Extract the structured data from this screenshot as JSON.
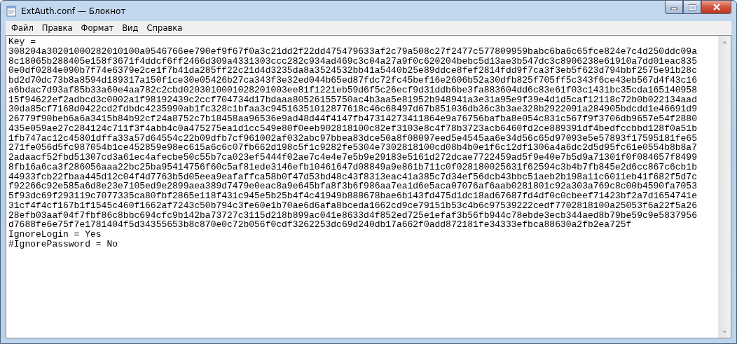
{
  "window": {
    "title": "ExtAuth.conf — Блокнот"
  },
  "menu": [
    "Файл",
    "Правка",
    "Формат",
    "Вид",
    "Справка"
  ],
  "lines": [
    "Key =",
    "308204a30201000282010100a0546766ee790ef9f67f0a3c21dd2f22dd475479633af2c79a508c27f2477c577809959babc6ba6c65fce824e7c4d250ddc09a",
    "8c18065b288405e158f3671f4ddcf6ff2466d309a4331303ccc282c934ad469c3c04a27a9f0c620204bebc5d13ae3b547dc3c8906238e61910a7dd01eac835",
    "0e0df0284e090b7f74e6379e2ce1f7b41da285ff22c21d4d3235da8a3524532bb41a5440b25e89ddce8fef2814fdd9f7ca3f3eb5f623d794bbf2575e91b28c",
    "bd2d70dc73b8a8594d189317a150f1ce30e05426b27ca343f3e32ed044b65ed87fdc72fc45bef16e2606b52a30dfb825f705ff5c343f6ce43eb567d4f43c16",
    "a6bdac7d93af85b33a60e4aa782c2cbd0203010001028201003ee81f1221eb59d6f5c26ecf9d31ddb6be3fa883604dd6c83e61f03c1431bc35cda165140958",
    "15f94622ef2adbcd3c0002a1f98192439c2ccf704734d17bdaaa80526155750ac4b3aa5e81952b948941a3e31a95e9f39e4d1d5caf12118c72b0b022134aad",
    "30da85cf7168d0422cd2fdbdc4235990ab1fc328c1bfaa3c94516351012877618c46c68497d67b851036db36c3b3ae328b2922091a284905bdcdd1e46691d9",
    "26779f90beb6a6a3415b84b92cf24a8752c7b18458aa96536e9ad48d44f4147fb47314273411864e9a76756bafba8e054c831c567f9f3706db9657e54f2880",
    "435e059ae27c284124c711f3f4abb4c0a475275ea1d1cc549e80f0eeb902818100c82ef3103e8c4f78b3723acb6460fd2ce889391df4bedfccbbd128f0a51b",
    "1fb747ac12c45801dffa33a57d64554c22b09dfb7cf961002af032abc97bbea83dce50a8f08097eed5e4545aa6e34d56c65d97093e5e57893f17595181fe65",
    "271fe056d5fc987054b1ce452859e98ec615a6c6c07fb662d198c5f1c9282fe5304e7302818100cd08b4b0e1f6c12df1306a4a6dc2d5d95fc61e0554b8b8a7",
    "2adaacf52fbd51307cd3a61ec4afecbe50c55b7ca023ef5444f02ae7c4e4e7e5b9e29183e5161d272dcae7722459ad5f9e40e7b5d9a71301f0f084657f8499",
    "8fb16a6ca3f286056aaa22bc25ba95414756f60c5af81ede3146efb10461647d08849a9e861b711c0f028180025631f62594c3b4b7fb845e2d6cc867c6cb1b",
    "44933fcb22fbaa445d12c04f4d7763b5d05eea9eafaffca58b0f47d53bd48c43f8313eac41a385c7d34ef56dcb43bbc51aeb2b198a11c6011eb41f682f5d7c",
    "f92266c92e585a6d8e23e7105ed9e2899aea389d7479e0eac8a9e645bfa8f3b6f986aa7ea1d6e5aca07076af6aab0281801c92a303a769c8c00b4590fa7053",
    "5f93dc69f293119c7077335ca80fbf2865e118f431c945e5b25b4f4c41949b888678bae6b143fd475d1dc18ad67687fd4df0c0cbeef71423bf2a7d1654741e",
    "31cf4f4cf167b1f1545c460f1662af7243c50b794c3fe60e1b70ae6d6afa8bceda1662cd9ce79151b53c4b6c97539222cedf7702818100a25053f6a22f5a26",
    "28efb03aaf04f7fbf86c8bbc694cfc9b142ba73727c3115d218b899ac041e8633d4f852ed725e1efaf3b56fb944c78ebde3ecb344aed8b79be59c9e5837956",
    "d7688fe6e75f7e1781404f5d34355653b8c870e0c72b056f0cdf3262253dc69d240db17a662f0add872181fe34333efbca88630a2fb2ea725f",
    "IgnoreLogin = Yes",
    "#IgnorePassword = No"
  ]
}
